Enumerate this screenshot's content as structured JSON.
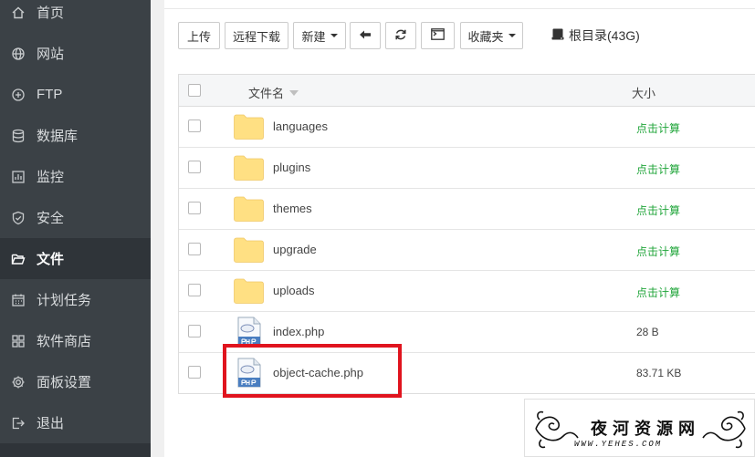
{
  "sidebar": {
    "items": [
      {
        "label": "首页",
        "icon": "home-icon",
        "active": false
      },
      {
        "label": "网站",
        "icon": "globe-icon",
        "active": false
      },
      {
        "label": "FTP",
        "icon": "ftp-icon",
        "active": false
      },
      {
        "label": "数据库",
        "icon": "database-icon",
        "active": false
      },
      {
        "label": "监控",
        "icon": "monitor-icon",
        "active": false
      },
      {
        "label": "安全",
        "icon": "shield-icon",
        "active": false
      },
      {
        "label": "文件",
        "icon": "folder-open-icon",
        "active": true
      },
      {
        "label": "计划任务",
        "icon": "calendar-icon",
        "active": false
      },
      {
        "label": "软件商店",
        "icon": "grid-icon",
        "active": false
      },
      {
        "label": "面板设置",
        "icon": "gear-icon",
        "active": false
      },
      {
        "label": "退出",
        "icon": "logout-icon",
        "active": false
      }
    ]
  },
  "toolbar": {
    "upload_label": "上传",
    "remote_download_label": "远程下载",
    "new_label": "新建",
    "back_icon": "arrow-left-icon",
    "refresh_icon": "refresh-icon",
    "terminal_icon": "terminal-icon",
    "favorites_label": "收藏夹",
    "disk_label": "根目录(43G)"
  },
  "table": {
    "header_name": "文件名",
    "header_size": "大小",
    "rows": [
      {
        "name": "languages",
        "type": "folder",
        "size": "点击计算"
      },
      {
        "name": "plugins",
        "type": "folder",
        "size": "点击计算"
      },
      {
        "name": "themes",
        "type": "folder",
        "size": "点击计算"
      },
      {
        "name": "upgrade",
        "type": "folder",
        "size": "点击计算"
      },
      {
        "name": "uploads",
        "type": "folder",
        "size": "点击计算"
      },
      {
        "name": "index.php",
        "type": "php",
        "size": "28 B"
      },
      {
        "name": "object-cache.php",
        "type": "php",
        "size": "83.71 KB"
      }
    ]
  },
  "watermark": {
    "title": "夜河资源网",
    "url": "WWW.YEHES.COM"
  },
  "colors": {
    "sidebar_bg": "#3b4146",
    "sidebar_active_bg": "#2f3439",
    "calc_green": "#20a53a",
    "highlight_red": "#e0141e",
    "folder_yellow": "#ffe083"
  }
}
